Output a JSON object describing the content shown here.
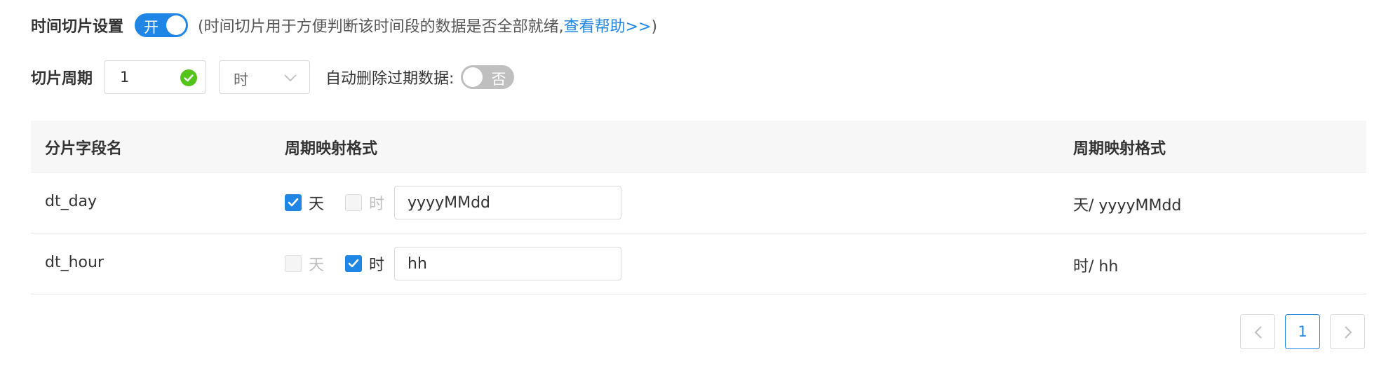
{
  "time_slice": {
    "label": "时间切片设置",
    "toggle_label": "开",
    "hint_prefix": "(时间切片用于方便判断该时间段的数据是否全部就绪,",
    "help_link": "查看帮助>>",
    "hint_suffix": ")"
  },
  "period": {
    "label": "切片周期",
    "value": "1",
    "unit": "时",
    "auto_delete_label": "自动删除过期数据:",
    "auto_delete_toggle": "否"
  },
  "table": {
    "headers": [
      "分片字段名",
      "周期映射格式",
      "周期映射格式"
    ],
    "rows": [
      {
        "field": "dt_day",
        "day_label": "天",
        "day_checked": true,
        "hour_label": "时",
        "hour_checked": false,
        "format": "yyyyMMdd",
        "mapping": "天/ yyyyMMdd"
      },
      {
        "field": "dt_hour",
        "day_label": "天",
        "day_checked": false,
        "hour_label": "时",
        "hour_checked": true,
        "format": "hh",
        "mapping": "时/ hh"
      }
    ]
  },
  "pagination": {
    "current": "1"
  },
  "colors": {
    "primary": "#1f86e6",
    "success": "#52c41a",
    "switch_off": "#bfbfbf"
  },
  "icons": {
    "valid": "check-circle-icon",
    "select": "chevron-down-icon",
    "prev": "chevron-left-icon",
    "next": "chevron-right-icon"
  }
}
